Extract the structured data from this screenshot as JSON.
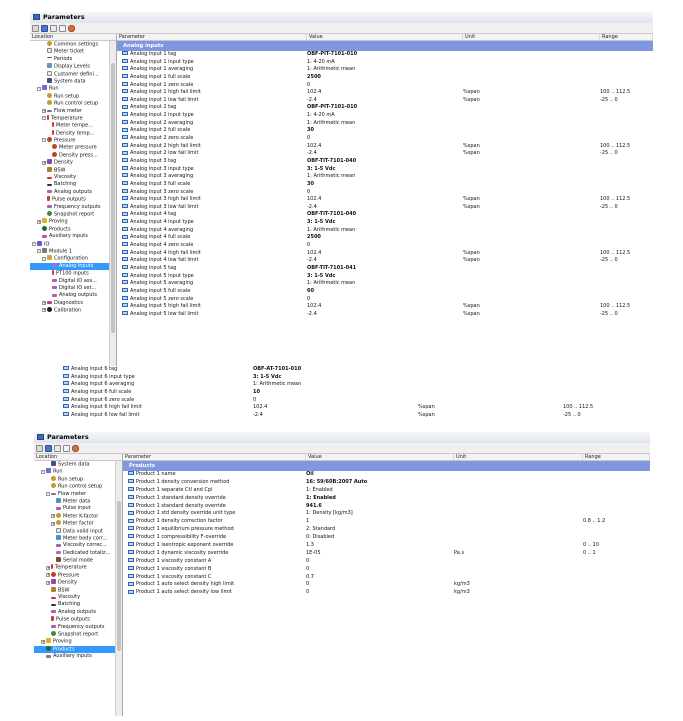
{
  "window1": {
    "title": "Parameters",
    "tree_header": "Location",
    "grid_headers": [
      "Parameter",
      "Value",
      "Unit",
      "Range"
    ],
    "section": "Analog inputs",
    "tree": [
      {
        "label": "Common settings",
        "icon": "gear",
        "indent": 3
      },
      {
        "label": "Meter ticket",
        "icon": "doc",
        "indent": 3
      },
      {
        "label": "Periods",
        "icon": "period",
        "indent": 3
      },
      {
        "label": "Display Levels",
        "icon": "display",
        "indent": 3
      },
      {
        "label": "Customer defini...",
        "icon": "doc",
        "indent": 3
      },
      {
        "label": "System data",
        "icon": "system",
        "indent": 3
      },
      {
        "label": "Run",
        "icon": "run",
        "indent": 1,
        "expander": "-"
      },
      {
        "label": "Run setup",
        "icon": "gear",
        "indent": 3
      },
      {
        "label": "Run control setup",
        "icon": "gear",
        "indent": 3
      },
      {
        "label": "Flow meter",
        "icon": "flow",
        "indent": 2,
        "expander": "+"
      },
      {
        "label": "Temperature",
        "icon": "temp",
        "indent": 2,
        "expander": "-"
      },
      {
        "label": "Meter tempe...",
        "icon": "temp",
        "indent": 4
      },
      {
        "label": "Density temp...",
        "icon": "temp",
        "indent": 4
      },
      {
        "label": "Pressure",
        "icon": "press",
        "indent": 2,
        "expander": "-"
      },
      {
        "label": "Meter pressure",
        "icon": "press",
        "indent": 4
      },
      {
        "label": "Density press...",
        "icon": "press",
        "indent": 4
      },
      {
        "label": "Density",
        "icon": "dens",
        "indent": 2,
        "expander": "+"
      },
      {
        "label": "BSW",
        "icon": "bsw",
        "indent": 3
      },
      {
        "label": "Viscosity",
        "icon": "visc",
        "indent": 3
      },
      {
        "label": "Batching",
        "icon": "batch",
        "indent": 3
      },
      {
        "label": "Analog outputs",
        "icon": "wave",
        "indent": 3
      },
      {
        "label": "Pulse outputs",
        "icon": "pulse",
        "indent": 3
      },
      {
        "label": "Frequency outputs",
        "icon": "wave",
        "indent": 3
      },
      {
        "label": "Snapshot report",
        "icon": "snap",
        "indent": 3
      },
      {
        "label": "Proving",
        "icon": "prove",
        "indent": 1,
        "expander": "+"
      },
      {
        "label": "Products",
        "icon": "prod",
        "indent": 2
      },
      {
        "label": "Auxiliary inputs",
        "icon": "wave",
        "indent": 2
      },
      {
        "label": "IO",
        "icon": "io",
        "indent": 0,
        "expander": "-"
      },
      {
        "label": "Module 1",
        "icon": "mod",
        "indent": 1,
        "expander": "-"
      },
      {
        "label": "Configuration",
        "icon": "cfg",
        "indent": 2,
        "expander": "-"
      },
      {
        "label": "Analog inputs",
        "icon": "ai",
        "indent": 4,
        "selected": true
      },
      {
        "label": "PT100 inputs",
        "icon": "temp",
        "indent": 4
      },
      {
        "label": "Digital IO ass...",
        "icon": "wave",
        "indent": 4
      },
      {
        "label": "Digital IO set...",
        "icon": "wave",
        "indent": 4
      },
      {
        "label": "Analog outputs",
        "icon": "wave",
        "indent": 4
      },
      {
        "label": "Diagnostics",
        "icon": "diag",
        "indent": 2,
        "expander": "+"
      },
      {
        "label": "Calibration",
        "icon": "calib",
        "indent": 2,
        "expander": "+"
      }
    ],
    "rows": [
      {
        "p": "Analog input 1 tag",
        "v": "OBF-PIT-7101-010",
        "u": "",
        "r": "",
        "b": true
      },
      {
        "p": "Analog input 1 input type",
        "v": "1: 4-20 mA",
        "u": "",
        "r": ""
      },
      {
        "p": "Analog input 1 averaging",
        "v": "1: Arithmetic mean",
        "u": "",
        "r": ""
      },
      {
        "p": "Analog input 1 full scale",
        "v": "2500",
        "u": "",
        "r": "",
        "b": true
      },
      {
        "p": "Analog input 1 zero scale",
        "v": "0",
        "u": "",
        "r": ""
      },
      {
        "p": "Analog input 1 high fail limit",
        "v": "102.4",
        "u": "%span",
        "r": "100 .. 112.5"
      },
      {
        "p": "Analog input 1 low fail limit",
        "v": "-2.4",
        "u": "%span",
        "r": "-25 .. 0"
      },
      {
        "p": "Analog input 2 tag",
        "v": "OBF-PIT-7101-010",
        "u": "",
        "r": "",
        "b": true
      },
      {
        "p": "Analog input 2 input type",
        "v": "1: 4-20 mA",
        "u": "",
        "r": ""
      },
      {
        "p": "Analog input 2 averaging",
        "v": "1: Arithmetic mean",
        "u": "",
        "r": ""
      },
      {
        "p": "Analog input 2 full scale",
        "v": "30",
        "u": "",
        "r": "",
        "b": true
      },
      {
        "p": "Analog input 2 zero scale",
        "v": "0",
        "u": "",
        "r": ""
      },
      {
        "p": "Analog input 2 high fail limit",
        "v": "102.4",
        "u": "%span",
        "r": "100 .. 112.5"
      },
      {
        "p": "Analog input 2 low fail limit",
        "v": "-2.4",
        "u": "%span",
        "r": "-25 .. 0"
      },
      {
        "p": "Analog input 3 tag",
        "v": "OBF-TIT-7101-040",
        "u": "",
        "r": "",
        "b": true
      },
      {
        "p": "Analog input 3 input type",
        "v": "3: 1-5 Vdc",
        "u": "",
        "r": "",
        "b": true
      },
      {
        "p": "Analog input 3 averaging",
        "v": "1: Arithmetic mean",
        "u": "",
        "r": ""
      },
      {
        "p": "Analog input 3 full scale",
        "v": "30",
        "u": "",
        "r": "",
        "b": true
      },
      {
        "p": "Analog input 3 zero scale",
        "v": "0",
        "u": "",
        "r": ""
      },
      {
        "p": "Analog input 3 high fail limit",
        "v": "102.4",
        "u": "%span",
        "r": "100 .. 112.5"
      },
      {
        "p": "Analog input 3 low fail limit",
        "v": "-2.4",
        "u": "%span",
        "r": "-25 .. 0"
      },
      {
        "p": "Analog input 4 tag",
        "v": "OBF-TIT-7101-040",
        "u": "",
        "r": "",
        "b": true
      },
      {
        "p": "Analog input 4 input type",
        "v": "3: 1-5 Vdc",
        "u": "",
        "r": "",
        "b": true
      },
      {
        "p": "Analog input 4 averaging",
        "v": "1: Arithmetic mean",
        "u": "",
        "r": ""
      },
      {
        "p": "Analog input 4 full scale",
        "v": "2500",
        "u": "",
        "r": "",
        "b": true
      },
      {
        "p": "Analog input 4 zero scale",
        "v": "0",
        "u": "",
        "r": ""
      },
      {
        "p": "Analog input 4 high fail limit",
        "v": "102.4",
        "u": "%span",
        "r": "100 .. 112.5"
      },
      {
        "p": "Analog input 4 low fail limit",
        "v": "-2.4",
        "u": "%span",
        "r": "-25 .. 0"
      },
      {
        "p": "Analog input 5 tag",
        "v": "OBF-TIT-7101-041",
        "u": "",
        "r": "",
        "b": true
      },
      {
        "p": "Analog input 5 input type",
        "v": "3: 1-5 Vdc",
        "u": "",
        "r": "",
        "b": true
      },
      {
        "p": "Analog input 5 averaging",
        "v": "1: Arithmetic mean",
        "u": "",
        "r": ""
      },
      {
        "p": "Analog input 5 full scale",
        "v": "60",
        "u": "",
        "r": "",
        "b": true
      },
      {
        "p": "Analog input 5 zero scale",
        "v": "0",
        "u": "",
        "r": ""
      },
      {
        "p": "Analog input 5 high fail limit",
        "v": "102.4",
        "u": "%span",
        "r": "100 .. 112.5"
      },
      {
        "p": "Analog input 5 low fail limit",
        "v": "-2.4",
        "u": "%span",
        "r": "-25 .. 0"
      }
    ]
  },
  "extension": {
    "rows": [
      {
        "p": "Analog input 6 tag",
        "v": "OBF-AT-7101-010",
        "u": "",
        "r": "",
        "b": true
      },
      {
        "p": "Analog input 6 input type",
        "v": "3: 1-5 Vdc",
        "u": "",
        "r": "",
        "b": true
      },
      {
        "p": "Analog input 6 averaging",
        "v": "1: Arithmetic mean",
        "u": "",
        "r": ""
      },
      {
        "p": "Analog input 6 full scale",
        "v": "10",
        "u": "",
        "r": "",
        "b": true
      },
      {
        "p": "Analog input 6 zero scale",
        "v": "0",
        "u": "",
        "r": ""
      },
      {
        "p": "Analog input 6 high fail limit",
        "v": "102.4",
        "u": "%span",
        "r": "100 .. 112.5"
      },
      {
        "p": "Analog input 6 low fail limit",
        "v": "-2.4",
        "u": "%span",
        "r": "-25 .. 0"
      }
    ]
  },
  "window2": {
    "title": "Parameters",
    "tree_header": "Location",
    "grid_headers": [
      "Parameter",
      "Value",
      "Unit",
      "Range"
    ],
    "section": "Products",
    "tree": [
      {
        "label": "System data",
        "icon": "system",
        "indent": 3
      },
      {
        "label": "Run",
        "icon": "run",
        "indent": 1,
        "expander": "-"
      },
      {
        "label": "Run setup",
        "icon": "gear",
        "indent": 3
      },
      {
        "label": "Run control setup",
        "icon": "gear",
        "indent": 3
      },
      {
        "label": "Flow meter",
        "icon": "flow",
        "indent": 2,
        "expander": "-"
      },
      {
        "label": "Meter data",
        "icon": "meter",
        "indent": 4
      },
      {
        "label": "Pulse input",
        "icon": "wave",
        "indent": 4
      },
      {
        "label": "Meter K-factor",
        "icon": "gear",
        "indent": 3,
        "expander": "+"
      },
      {
        "label": "Meter factor",
        "icon": "gear",
        "indent": 3,
        "expander": "+"
      },
      {
        "label": "Data valid input",
        "icon": "doc",
        "indent": 4
      },
      {
        "label": "Meter body corr...",
        "icon": "meter",
        "indent": 4
      },
      {
        "label": "Viscosity correc...",
        "icon": "wave",
        "indent": 4
      },
      {
        "label": "Dedicated totaliz...",
        "icon": "ai",
        "indent": 4
      },
      {
        "label": "Serial mode",
        "icon": "serial",
        "indent": 4
      },
      {
        "label": "Temperature",
        "icon": "temp",
        "indent": 2,
        "expander": "+"
      },
      {
        "label": "Pressure",
        "icon": "press",
        "indent": 2,
        "expander": "+"
      },
      {
        "label": "Density",
        "icon": "dens",
        "indent": 2,
        "expander": "+"
      },
      {
        "label": "BSW",
        "icon": "bsw",
        "indent": 3
      },
      {
        "label": "Viscosity",
        "icon": "visc",
        "indent": 3
      },
      {
        "label": "Batching",
        "icon": "batch",
        "indent": 3
      },
      {
        "label": "Analog outputs",
        "icon": "wave",
        "indent": 3
      },
      {
        "label": "Pulse outputs",
        "icon": "pulse",
        "indent": 3
      },
      {
        "label": "Frequency outputs",
        "icon": "wave",
        "indent": 3
      },
      {
        "label": "Snapshot report",
        "icon": "snap",
        "indent": 3
      },
      {
        "label": "Proving",
        "icon": "prove",
        "indent": 1,
        "expander": "+"
      },
      {
        "label": "Products",
        "icon": "prod",
        "indent": 2,
        "selected": true
      },
      {
        "label": "Auxiliary inputs",
        "icon": "wave",
        "indent": 2
      }
    ],
    "rows": [
      {
        "p": "Product 1 name",
        "v": "Oil",
        "u": "",
        "r": "",
        "b": true
      },
      {
        "p": "Product 1 density conversion method",
        "v": "16: 59/60B:2007 Auto",
        "u": "",
        "r": "",
        "b": true
      },
      {
        "p": "Product 1 separate Ctl and Cpl",
        "v": "1: Enabled",
        "u": "",
        "r": ""
      },
      {
        "p": "Product 1 standard density override",
        "v": "1: Enabled",
        "u": "",
        "r": "",
        "b": true
      },
      {
        "p": "Product 1 standard density override",
        "v": "941.6",
        "u": "",
        "r": "",
        "b": true
      },
      {
        "p": "Product 1 std density override unit type",
        "v": "1: Density [kg/m3]",
        "u": "",
        "r": ""
      },
      {
        "p": "Product 1 density correction factor",
        "v": "1",
        "u": "",
        "r": "0.8 .. 1.2"
      },
      {
        "p": "Product 1 equilibrium pressure method",
        "v": "2: Standard",
        "u": "",
        "r": ""
      },
      {
        "p": "Product 1 compressibility F-override",
        "v": "0: Disabled",
        "u": "",
        "r": ""
      },
      {
        "p": "Product 1 isentropic exponent override",
        "v": "1.3",
        "u": "",
        "r": "0 .. 10"
      },
      {
        "p": "Product 1 dynamic viscosity override",
        "v": "1E-05",
        "u": "Pa.s",
        "r": "0 .. 1"
      },
      {
        "p": "Product 1 viscosity constant A",
        "v": "0",
        "u": "",
        "r": ""
      },
      {
        "p": "Product 1 viscosity constant B",
        "v": "0",
        "u": "",
        "r": ""
      },
      {
        "p": "Product 1 viscosity constant C",
        "v": "0.7",
        "u": "",
        "r": ""
      },
      {
        "p": "Product 1 auto select density high limit",
        "v": "0",
        "u": "kg/m3",
        "r": ""
      },
      {
        "p": "Product 1 auto select density low limit",
        "v": "0",
        "u": "kg/m3",
        "r": ""
      }
    ]
  }
}
